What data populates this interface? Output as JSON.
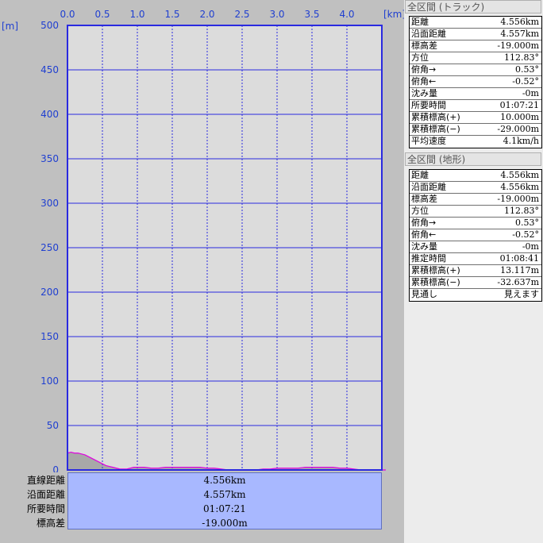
{
  "chart_data": {
    "type": "area",
    "x_unit": "[km]",
    "y_unit": "[m]",
    "xlim": [
      0,
      4.5
    ],
    "ylim": [
      0,
      500
    ],
    "x_ticks": [
      "0.0",
      "0.5",
      "1.0",
      "1.5",
      "2.0",
      "2.5",
      "3.0",
      "3.5",
      "4.0"
    ],
    "y_ticks": [
      "500",
      "450",
      "400",
      "350",
      "300",
      "250",
      "200",
      "150",
      "100",
      "50",
      "0"
    ],
    "grid": true,
    "line_color": "#e000e0",
    "fill_color": "#a8a8a8",
    "plot_background": "#dcdcdc",
    "grid_color": "#2a2ae0",
    "series": [
      {
        "x": [
          0.0,
          0.05,
          0.1,
          0.15,
          0.2,
          0.25,
          0.3,
          0.35,
          0.4,
          0.45,
          0.5,
          0.55,
          0.6,
          0.65,
          0.7,
          0.75,
          0.8,
          0.85,
          0.9,
          0.95,
          1.0,
          1.1,
          1.2,
          1.3,
          1.4,
          1.5,
          1.6,
          1.7,
          1.8,
          1.9,
          2.0,
          2.1,
          2.2,
          2.3,
          2.4,
          2.5,
          2.6,
          2.7,
          2.8,
          2.9,
          3.0,
          3.1,
          3.2,
          3.3,
          3.4,
          3.5,
          3.6,
          3.7,
          3.8,
          3.9,
          4.0,
          4.1,
          4.2,
          4.3,
          4.4,
          4.556
        ],
        "y": [
          19,
          20,
          19,
          19,
          18,
          17,
          15,
          13,
          11,
          9,
          7,
          5,
          4,
          3,
          2,
          1,
          1,
          1,
          2,
          3,
          3,
          3,
          2,
          2,
          3,
          3,
          3,
          3,
          3,
          3,
          2,
          2,
          1,
          0,
          0,
          0,
          0,
          0,
          1,
          1,
          2,
          2,
          2,
          2,
          3,
          3,
          3,
          3,
          3,
          2,
          2,
          1,
          0,
          0,
          0,
          0
        ]
      }
    ]
  },
  "summary": {
    "labels": [
      "直線距離",
      "沿面距離",
      "所要時間",
      "標高差"
    ],
    "values": [
      "4.556km",
      "4.557km",
      "01:07:21",
      "-19.000m"
    ]
  },
  "track_panel": {
    "title": "全区間 (トラック)",
    "rows": [
      {
        "label": "距離",
        "value": "4.556km"
      },
      {
        "label": "沿面距離",
        "value": "4.557km"
      },
      {
        "label": "標高差",
        "value": "-19.000m"
      },
      {
        "label": "方位",
        "value": "112.83°"
      },
      {
        "label": "俯角→",
        "value": "0.53°"
      },
      {
        "label": "俯角←",
        "value": "-0.52°"
      },
      {
        "label": "沈み量",
        "value": "-0m"
      },
      {
        "label": "所要時間",
        "value": "01:07:21"
      },
      {
        "label": "累積標高(+)",
        "value": "10.000m"
      },
      {
        "label": "累積標高(−)",
        "value": "-29.000m"
      },
      {
        "label": "平均速度",
        "value": "4.1km/h"
      }
    ]
  },
  "terrain_panel": {
    "title": "全区間 (地形)",
    "rows": [
      {
        "label": "距離",
        "value": "4.556km"
      },
      {
        "label": "沿面距離",
        "value": "4.556km"
      },
      {
        "label": "標高差",
        "value": "-19.000m"
      },
      {
        "label": "方位",
        "value": "112.83°"
      },
      {
        "label": "俯角→",
        "value": "0.53°"
      },
      {
        "label": "俯角←",
        "value": "-0.52°"
      },
      {
        "label": "沈み量",
        "value": "-0m"
      },
      {
        "label": "推定時間",
        "value": "01:08:41"
      },
      {
        "label": "累積標高(+)",
        "value": "13.117m"
      },
      {
        "label": "累積標高(−)",
        "value": "-32.637m"
      },
      {
        "label": "見通し",
        "value": "見えます"
      }
    ]
  }
}
